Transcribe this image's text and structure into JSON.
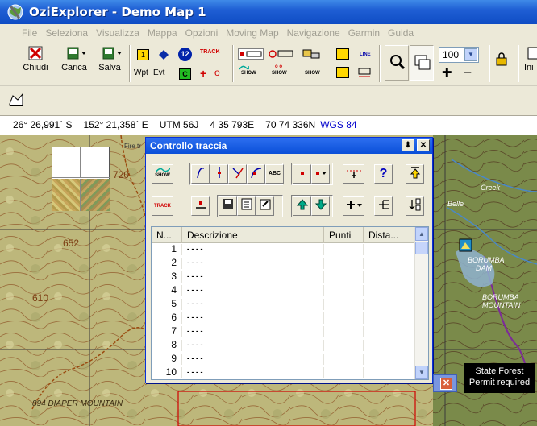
{
  "window": {
    "title": "OziExplorer - Demo Map 1"
  },
  "menu": [
    "File",
    "Seleziona",
    "Visualizza",
    "Mappa",
    "Opzioni",
    "Moving Map",
    "Navigazione",
    "Garmin",
    "Guida"
  ],
  "toolbar": {
    "close_label": "Chiudi",
    "load_label": "Carica",
    "save_label": "Salva",
    "wpt_label": "Wpt",
    "evt_label": "Evt",
    "track_badge": "TRACK",
    "show_badge": "SHOW",
    "line_badge": "LINE",
    "count_badge": "12",
    "waypoint_badge": "1",
    "event_badge": "C",
    "zoom_value": "100",
    "right_label": "Ini"
  },
  "coords": {
    "lat": "26° 26,991´ S",
    "lon": "152° 21,358´ E",
    "utm_zone": "UTM  56J",
    "easting": "4 35 793E",
    "northing": "70 74 336N",
    "datum": "WGS 84"
  },
  "map_labels": {
    "fire_tr": "Fire tr",
    "n720": "720",
    "n652": "652",
    "n610": "610",
    "n894": "894 DIAPER MOUNTAIN",
    "borumba1": "BORUMBA",
    "borumba1b": "DAM",
    "borumba2": "BORUMBA",
    "borumba2b": "MOUNTAIN",
    "creek": "Creek",
    "belle": "Belle"
  },
  "dialog": {
    "title": "Controllo traccia",
    "show_btn": "SHOW",
    "abc_btn": "ABC",
    "track_btn": "TRACK",
    "help_btn": "?",
    "columns": [
      "N...",
      "Descrizione",
      "Punti",
      "Dista..."
    ],
    "rows": [
      {
        "n": "1",
        "desc": "- - - -"
      },
      {
        "n": "2",
        "desc": "- - - -"
      },
      {
        "n": "3",
        "desc": "- - - -"
      },
      {
        "n": "4",
        "desc": "- - - -"
      },
      {
        "n": "5",
        "desc": "- - - -"
      },
      {
        "n": "6",
        "desc": "- - - -"
      },
      {
        "n": "7",
        "desc": "- - - -"
      },
      {
        "n": "8",
        "desc": "- - - -"
      },
      {
        "n": "9",
        "desc": "- - - -"
      },
      {
        "n": "10",
        "desc": "- - - -"
      }
    ]
  },
  "tooltip": {
    "line1": "State Forest",
    "line2": "Permit required"
  },
  "colors": {
    "title_blue": "#0f4cc4",
    "map_olive": "#b9b67a",
    "contour_brown": "#a0522d"
  }
}
